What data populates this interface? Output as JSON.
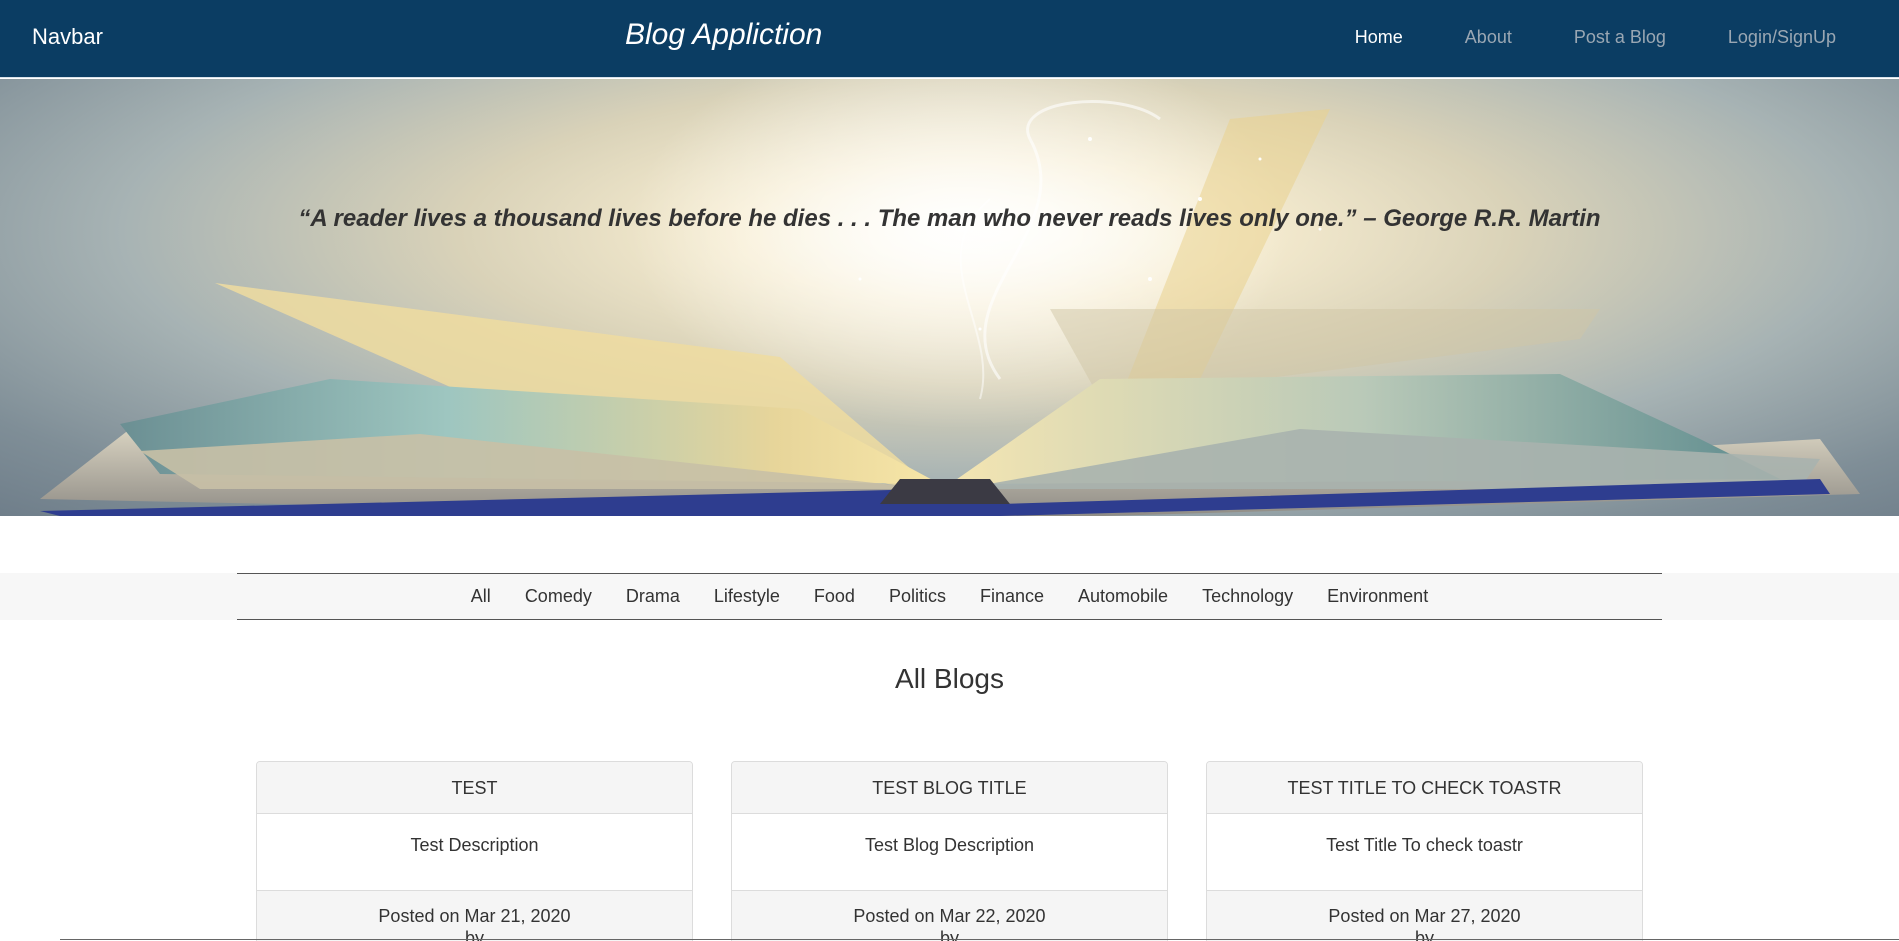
{
  "navbar": {
    "brand": "Navbar",
    "title": "Blog Appliction",
    "links": [
      {
        "label": "Home",
        "active": true
      },
      {
        "label": "About",
        "active": false
      },
      {
        "label": "Post a Blog",
        "active": false
      },
      {
        "label": "Login/SignUp",
        "active": false
      }
    ]
  },
  "hero": {
    "quote": "“A reader lives a thousand lives before he dies . . . The man who never reads lives only one.” – George R.R. Martin"
  },
  "categories": [
    "All",
    "Comedy",
    "Drama",
    "Lifestyle",
    "Food",
    "Politics",
    "Finance",
    "Automobile",
    "Technology",
    "Environment"
  ],
  "main": {
    "section_title": "All Blogs"
  },
  "blogs": [
    {
      "title": "TEST",
      "description": "Test Description",
      "posted": "Posted on Mar 21, 2020",
      "by": "by"
    },
    {
      "title": "TEST BLOG TITLE",
      "description": "Test Blog Description",
      "posted": "Posted on Mar 22, 2020",
      "by": "by"
    },
    {
      "title": "TEST TITLE TO CHECK TOASTR",
      "description": "Test Title To check toastr",
      "posted": "Posted on Mar 27, 2020",
      "by": "by"
    }
  ],
  "colors": {
    "navbar_bg": "#0b3d63",
    "nav_active": "#ffffff",
    "nav_inactive": "#9aa7b3"
  }
}
